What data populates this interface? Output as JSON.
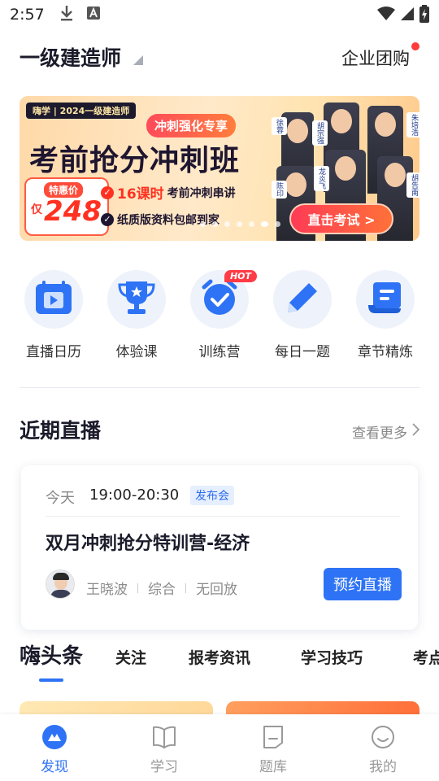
{
  "status_bar": {
    "time": "2:57",
    "icons": [
      "download-icon",
      "font-a-icon",
      "wifi-icon",
      "signal-icon",
      "battery-icon"
    ]
  },
  "header": {
    "cert_selector": "一级建造师",
    "enterprise_label": "企业团购",
    "enterprise_has_dot": true
  },
  "banner": {
    "brand": "嗨学 | 2024一级建造师",
    "tag": "冲刺强化专享",
    "title": "考前抢分冲刺班",
    "price_label": "特惠价",
    "price_prefix": "仅",
    "price": "248",
    "feature_1_highlight": "16课时",
    "feature_1_text": "考前冲刺串讲",
    "feature_2_text": "纸质版资料包邮到家",
    "teachers": [
      "徐蓉",
      "胡宗强",
      "朱培浩",
      "陈印",
      "龙炎飞",
      "胡告南"
    ],
    "cta": "直击考试 >",
    "slides": 7,
    "active_slide": 5
  },
  "quick_menu": [
    {
      "label": "直播日历",
      "icon": "calendar-play-icon"
    },
    {
      "label": "体验课",
      "icon": "trophy-icon"
    },
    {
      "label": "训练营",
      "icon": "alarm-check-icon",
      "badge": "HOT"
    },
    {
      "label": "每日一题",
      "icon": "pencil-icon"
    },
    {
      "label": "章节精炼",
      "icon": "scroll-icon"
    }
  ],
  "recent_live": {
    "title": "近期直播",
    "more": "查看更多",
    "card": {
      "day": "今天",
      "time": "19:00-20:30",
      "badge": "发布会",
      "title": "双月冲刺抢分特训营-经济",
      "teacher": "王晓波",
      "subject": "综合",
      "replay": "无回放",
      "button": "预约直播"
    }
  },
  "tabs": [
    {
      "label": "嗨头条",
      "active": true
    },
    {
      "label": "关注"
    },
    {
      "label": "报考资讯"
    },
    {
      "label": "学习技巧"
    },
    {
      "label": "考点"
    }
  ],
  "bottom_nav": [
    {
      "label": "发现",
      "icon": "discover-icon",
      "active": true
    },
    {
      "label": "学习",
      "icon": "book-icon"
    },
    {
      "label": "题库",
      "icon": "question-bank-icon"
    },
    {
      "label": "我的",
      "icon": "profile-icon"
    }
  ],
  "colors": {
    "accent": "#2e73f5",
    "hot": "#ff3b46",
    "price": "#ff3222"
  }
}
